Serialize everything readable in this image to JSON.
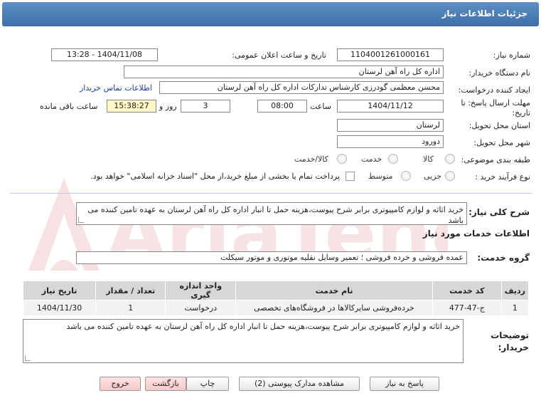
{
  "header": {
    "title": "جزئیات اطلاعات نیاز"
  },
  "form": {
    "need_number_label": "شماره نیاز:",
    "need_number": "1104001261000161",
    "announce_label": "تاریخ و ساعت اعلان عمومی:",
    "announce_value": "1404/11/08 - 13:28",
    "buyer_org_label": "نام دستگاه خریدار:",
    "buyer_org": "اداره کل راه آهن لرستان",
    "creator_label": "ایجاد کننده درخواست:",
    "creator": "محسن معظمی گودرزی کارشناس تدارکات اداره کل راه آهن لرستان",
    "contact_link": "اطلاعات تماس خریدار",
    "deadline_label_1": "مهلت ارسال پاسخ: تا",
    "deadline_label_2": "تاریخ:",
    "deadline_date": "1404/11/12",
    "time_label": "ساعت",
    "deadline_time": "08:00",
    "days_value": "3",
    "days_label": "روز و",
    "remaining_time": "15:38:27",
    "remaining_label": "ساعت باقی مانده",
    "province_label": "استان محل تحویل:",
    "province": "لرستان",
    "city_label": "شهر محل تحویل:",
    "city": "دورود",
    "category_label": "طبقه بندی موضوعی:",
    "category_options": [
      "کالا",
      "خدمت",
      "کالا/خدمت"
    ],
    "process_label": "نوع فرآیند خرید :",
    "process_options": [
      "جزیی",
      "متوسط"
    ],
    "payment_note": "پرداخت تمام یا بخشی از مبلغ خرید،از محل \"اسناد خزانه اسلامی\" خواهد بود."
  },
  "description": {
    "label": "شرح کلی نیاز:",
    "text": "خرید اثاثه و لوازم کامپیوتری برابر شرح پیوست،هزینه حمل تا انبار اداره کل راه آهن لرستان به عهده تامین کننده می باشد"
  },
  "services": {
    "section_title": "اطلاعات خدمات مورد نیاز",
    "group_label": "گروه خدمت:",
    "group_value": "عمده فروشی و خرده فروشی ؛ تعمیر وسایل نقلیه موتوری و موتور سیکلت",
    "columns": [
      "ردیف",
      "کد خدمت",
      "نام خدمت",
      "واحد اندازه گیری",
      "تعداد / مقدار",
      "تاریخ نیاز"
    ],
    "rows": [
      [
        "1",
        "ج-47-477",
        "خرده‌فروشی سایرکالاها در فروشگاه‌های تخصصی",
        "درخواست",
        "1",
        "1404/11/30"
      ]
    ]
  },
  "buyer_notes": {
    "label_1": "توضیحات",
    "label_2": "خریدار:",
    "text": "خرید اثاثه و لوازم کامپیوتری برابر شرح پیوست،هزینه حمل تا انبار اداره کل راه آهن لرستان به عهده تامین کننده می باشد"
  },
  "buttons": {
    "reply": "پاسخ به نیاز",
    "attachments": "مشاهده مدارک پیوستی (2)",
    "print": "چاپ",
    "back": "بازگشت",
    "exit": "خروج"
  },
  "watermark": {
    "text": "AriaTender.net"
  },
  "colors": {
    "header": "#4a7db8",
    "yellow_field": "#fff7c8",
    "link": "#1a3ea8"
  }
}
